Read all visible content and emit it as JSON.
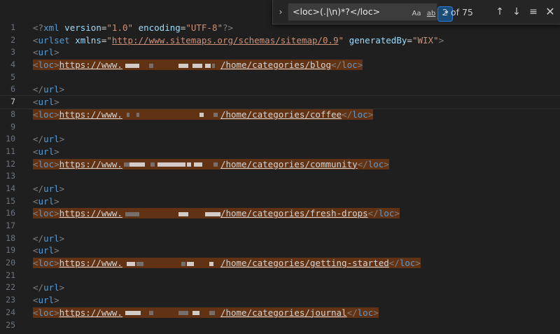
{
  "find_widget": {
    "toggle_icon": "chevron-right-icon",
    "search_value": "<loc>(.|\\n)*?</loc>",
    "match_case_label": "Aa",
    "whole_word_label": "ab",
    "regex_label": ".*",
    "result_count": "2 of 75",
    "prev_icon": "arrow-up-icon",
    "next_icon": "arrow-down-icon",
    "selection_icon": "find-in-selection-icon",
    "close_icon": "close-icon"
  },
  "editor": {
    "current_line": 7,
    "lines": [
      {
        "num": "1",
        "text": "<?xml version=\"1.0\" encoding=\"UTF-8\"?>"
      },
      {
        "num": "2",
        "text": "<urlset xmlns=\"http://www.sitemaps.org/schemas/sitemap/0.9\" generatedBy=\"WIX\">"
      },
      {
        "num": "3",
        "text": "<url>"
      },
      {
        "num": "4",
        "loc_prefix": "https://www.",
        "loc_suffix": "/home/categories/blog"
      },
      {
        "num": "5",
        "text": ""
      },
      {
        "num": "6",
        "text": "</url>"
      },
      {
        "num": "7",
        "text": "<url>"
      },
      {
        "num": "8",
        "loc_prefix": "https://www.",
        "loc_suffix": "/home/categories/coffee"
      },
      {
        "num": "9",
        "text": ""
      },
      {
        "num": "10",
        "text": "</url>"
      },
      {
        "num": "11",
        "text": "<url>"
      },
      {
        "num": "12",
        "loc_prefix": "https://www.",
        "loc_suffix": "/home/categories/community"
      },
      {
        "num": "13",
        "text": ""
      },
      {
        "num": "14",
        "text": "</url>"
      },
      {
        "num": "15",
        "text": "<url>"
      },
      {
        "num": "16",
        "loc_prefix": "https://www.",
        "loc_suffix": "/home/categories/fresh-drops"
      },
      {
        "num": "17",
        "text": ""
      },
      {
        "num": "18",
        "text": "</url>"
      },
      {
        "num": "19",
        "text": "<url>"
      },
      {
        "num": "20",
        "loc_prefix": "https://www.",
        "loc_suffix": "/home/categories/getting-started"
      },
      {
        "num": "21",
        "text": ""
      },
      {
        "num": "22",
        "text": "</url>"
      },
      {
        "num": "23",
        "text": "<url>"
      },
      {
        "num": "24",
        "loc_prefix": "https://www.",
        "loc_suffix": "/home/categories/journal"
      },
      {
        "num": "25",
        "text": ""
      }
    ]
  },
  "syntax": {
    "xml_decl": {
      "open": "<?",
      "name": "xml",
      "attr1": "version",
      "eq1": "=",
      "val1": "\"1.0\"",
      "attr2": "encoding",
      "eq2": "=",
      "val2": "\"UTF-8\"",
      "close": "?>"
    },
    "urlset": {
      "open": "<",
      "name": "urlset",
      "attr1": "xmlns",
      "eq1": "=",
      "val1_q": "\"",
      "val1_url": "http://www.sitemaps.org/schemas/sitemap/0.9",
      "attr2": "generatedBy",
      "eq2": "=",
      "val2": "\"WIX\"",
      "close": ">"
    },
    "loc_open": "<loc>",
    "loc_close": "</loc>"
  },
  "colors": {
    "background": "#1f1f1f",
    "match_highlight": "#613214",
    "tag": "#569cd6",
    "attribute": "#9cdcfe",
    "string": "#ce9178",
    "regex_toggle_active": "#1a4d7a"
  }
}
